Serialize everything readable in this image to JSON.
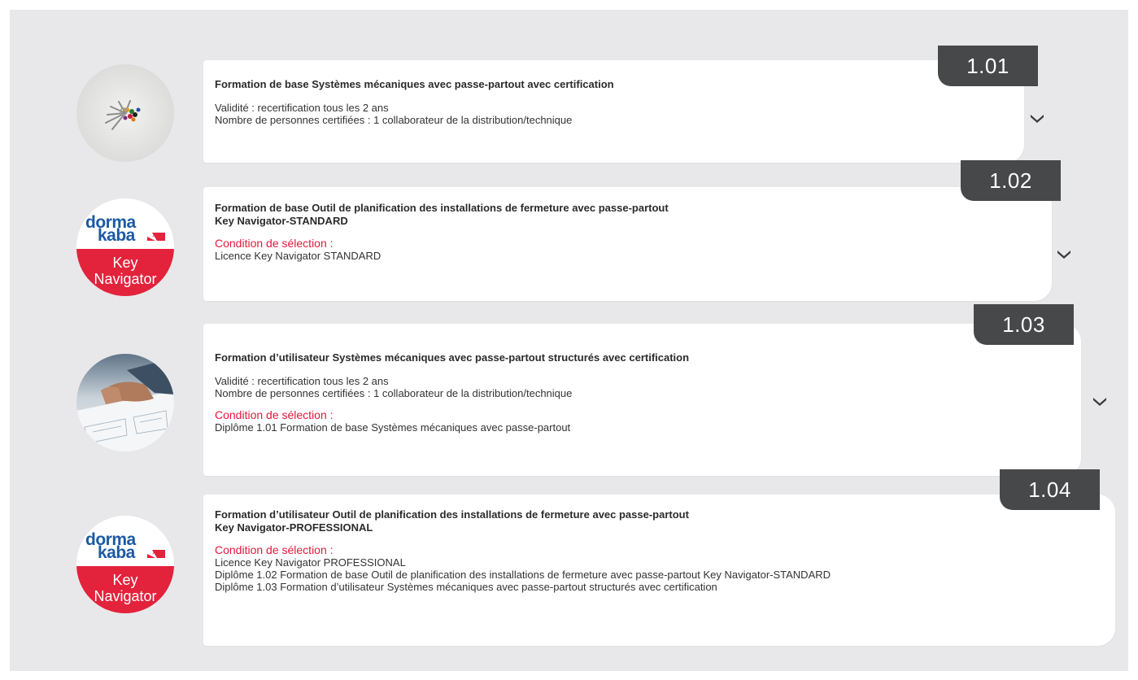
{
  "items": [
    {
      "code": "1.01",
      "title_lines": [
        "Formation de base Systèmes mécaniques avec passe-partout avec certification"
      ],
      "info_lines": [
        "Validité : recertification tous les 2 ans",
        "Nombre de personnes certifiées : 1 collaborateur de la distribution/technique"
      ],
      "condition_label": "",
      "condition_lines": [],
      "image": "keys-photo"
    },
    {
      "code": "1.02",
      "title_lines": [
        "Formation de base Outil de planification des installations de fermeture avec passe-partout",
        "Key Navigator-STANDARD"
      ],
      "info_lines": [],
      "condition_label": "Condition de sélection :",
      "condition_lines": [
        "Licence Key Navigator STANDARD"
      ],
      "image": "dormakaba-key-navigator-logo"
    },
    {
      "code": "1.03",
      "title_lines": [
        "Formation d’utilisateur Systèmes mécaniques avec passe-partout structurés avec certification"
      ],
      "info_lines": [
        "Validité : recertification tous les 2 ans",
        "Nombre de personnes certifiées : 1 collaborateur de la distribution/technique"
      ],
      "condition_label": "Condition de sélection :",
      "condition_lines": [
        "Diplôme 1.01 Formation de base Systèmes mécaniques avec passe-partout"
      ],
      "image": "blueprint-photo"
    },
    {
      "code": "1.04",
      "title_lines": [
        "Formation d’utilisateur Outil de planification des installations de fermeture avec passe-partout",
        "Key Navigator-PROFESSIONAL"
      ],
      "info_lines": [],
      "condition_label": "Condition de sélection :",
      "condition_lines": [
        "Licence Key Navigator PROFESSIONAL",
        "Diplôme 1.02 Formation de base Outil de planification des installations de fermeture avec passe-partout Key Navigator-STANDARD",
        "Diplôme 1.03 Formation d’utilisateur Systèmes mécaniques avec passe-partout structurés avec certification"
      ],
      "image": "dormakaba-key-navigator-logo"
    }
  ],
  "logo": {
    "word1": "dorma",
    "word2": "kaba",
    "key_line1": "Key",
    "key_line2": "Navigator"
  },
  "icons": {
    "expand": "chevron-down-icon"
  },
  "colors": {
    "panel_bg": "#e8e8ea",
    "tag_bg": "#474849",
    "condition_red": "#e2183d",
    "brand_blue": "#1c5aa4",
    "brand_red": "#e3223c"
  }
}
